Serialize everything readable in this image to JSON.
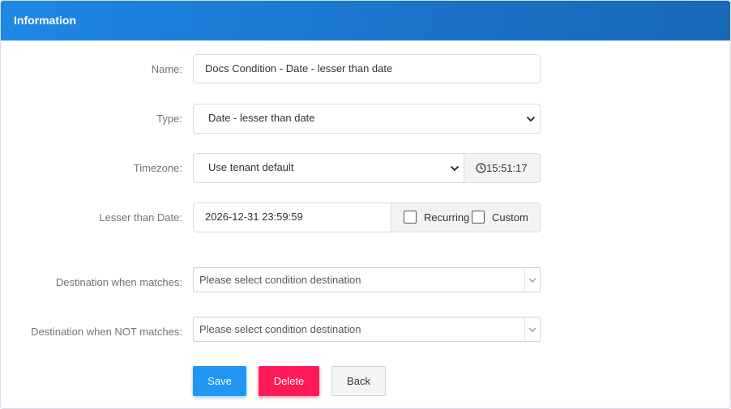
{
  "header": {
    "title": "Information"
  },
  "form": {
    "name": {
      "label": "Name:",
      "value": "Docs Condition - Date - lesser than date"
    },
    "type": {
      "label": "Type:",
      "value": "Date - lesser than date"
    },
    "timezone": {
      "label": "Timezone:",
      "value": "Use tenant default",
      "time": "15:51:17"
    },
    "lesser_than_date": {
      "label": "Lesser than Date:",
      "value": "2026-12-31 23:59:59",
      "recurring_label": "Recurring",
      "recurring_checked": false,
      "custom_label": "Custom",
      "custom_checked": false
    },
    "dest_match": {
      "label": "Destination when matches:",
      "placeholder": "Please select condition destination"
    },
    "dest_not_match": {
      "label": "Destination when NOT matches:",
      "placeholder": "Please select condition destination"
    }
  },
  "actions": {
    "save": "Save",
    "delete": "Delete",
    "back": "Back"
  },
  "colors": {
    "header": "#1e88e5",
    "save": "#2196f3",
    "delete": "#ff1a57"
  },
  "icons": {
    "chevron": "chevron-down-icon",
    "clock": "clock-icon"
  }
}
